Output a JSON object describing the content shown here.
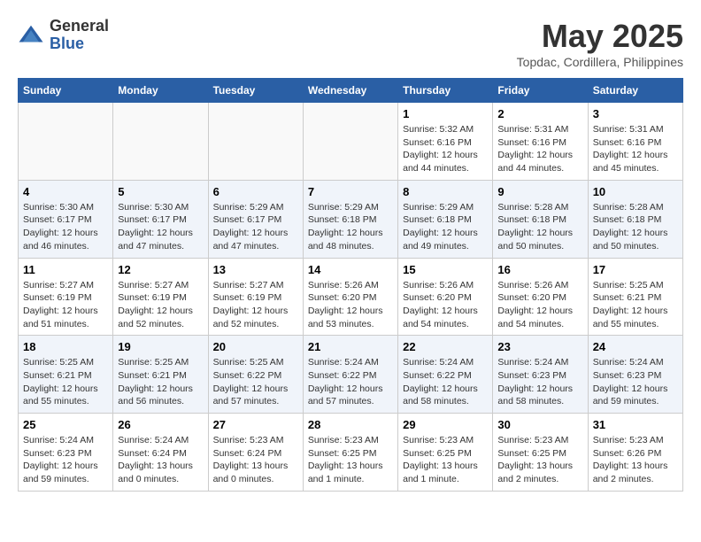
{
  "logo": {
    "general": "General",
    "blue": "Blue"
  },
  "title": "May 2025",
  "subtitle": "Topdac, Cordillera, Philippines",
  "days_of_week": [
    "Sunday",
    "Monday",
    "Tuesday",
    "Wednesday",
    "Thursday",
    "Friday",
    "Saturday"
  ],
  "weeks": [
    [
      {
        "day": "",
        "info": ""
      },
      {
        "day": "",
        "info": ""
      },
      {
        "day": "",
        "info": ""
      },
      {
        "day": "",
        "info": ""
      },
      {
        "day": "1",
        "info": "Sunrise: 5:32 AM\nSunset: 6:16 PM\nDaylight: 12 hours\nand 44 minutes."
      },
      {
        "day": "2",
        "info": "Sunrise: 5:31 AM\nSunset: 6:16 PM\nDaylight: 12 hours\nand 44 minutes."
      },
      {
        "day": "3",
        "info": "Sunrise: 5:31 AM\nSunset: 6:16 PM\nDaylight: 12 hours\nand 45 minutes."
      }
    ],
    [
      {
        "day": "4",
        "info": "Sunrise: 5:30 AM\nSunset: 6:17 PM\nDaylight: 12 hours\nand 46 minutes."
      },
      {
        "day": "5",
        "info": "Sunrise: 5:30 AM\nSunset: 6:17 PM\nDaylight: 12 hours\nand 47 minutes."
      },
      {
        "day": "6",
        "info": "Sunrise: 5:29 AM\nSunset: 6:17 PM\nDaylight: 12 hours\nand 47 minutes."
      },
      {
        "day": "7",
        "info": "Sunrise: 5:29 AM\nSunset: 6:18 PM\nDaylight: 12 hours\nand 48 minutes."
      },
      {
        "day": "8",
        "info": "Sunrise: 5:29 AM\nSunset: 6:18 PM\nDaylight: 12 hours\nand 49 minutes."
      },
      {
        "day": "9",
        "info": "Sunrise: 5:28 AM\nSunset: 6:18 PM\nDaylight: 12 hours\nand 50 minutes."
      },
      {
        "day": "10",
        "info": "Sunrise: 5:28 AM\nSunset: 6:18 PM\nDaylight: 12 hours\nand 50 minutes."
      }
    ],
    [
      {
        "day": "11",
        "info": "Sunrise: 5:27 AM\nSunset: 6:19 PM\nDaylight: 12 hours\nand 51 minutes."
      },
      {
        "day": "12",
        "info": "Sunrise: 5:27 AM\nSunset: 6:19 PM\nDaylight: 12 hours\nand 52 minutes."
      },
      {
        "day": "13",
        "info": "Sunrise: 5:27 AM\nSunset: 6:19 PM\nDaylight: 12 hours\nand 52 minutes."
      },
      {
        "day": "14",
        "info": "Sunrise: 5:26 AM\nSunset: 6:20 PM\nDaylight: 12 hours\nand 53 minutes."
      },
      {
        "day": "15",
        "info": "Sunrise: 5:26 AM\nSunset: 6:20 PM\nDaylight: 12 hours\nand 54 minutes."
      },
      {
        "day": "16",
        "info": "Sunrise: 5:26 AM\nSunset: 6:20 PM\nDaylight: 12 hours\nand 54 minutes."
      },
      {
        "day": "17",
        "info": "Sunrise: 5:25 AM\nSunset: 6:21 PM\nDaylight: 12 hours\nand 55 minutes."
      }
    ],
    [
      {
        "day": "18",
        "info": "Sunrise: 5:25 AM\nSunset: 6:21 PM\nDaylight: 12 hours\nand 55 minutes."
      },
      {
        "day": "19",
        "info": "Sunrise: 5:25 AM\nSunset: 6:21 PM\nDaylight: 12 hours\nand 56 minutes."
      },
      {
        "day": "20",
        "info": "Sunrise: 5:25 AM\nSunset: 6:22 PM\nDaylight: 12 hours\nand 57 minutes."
      },
      {
        "day": "21",
        "info": "Sunrise: 5:24 AM\nSunset: 6:22 PM\nDaylight: 12 hours\nand 57 minutes."
      },
      {
        "day": "22",
        "info": "Sunrise: 5:24 AM\nSunset: 6:22 PM\nDaylight: 12 hours\nand 58 minutes."
      },
      {
        "day": "23",
        "info": "Sunrise: 5:24 AM\nSunset: 6:23 PM\nDaylight: 12 hours\nand 58 minutes."
      },
      {
        "day": "24",
        "info": "Sunrise: 5:24 AM\nSunset: 6:23 PM\nDaylight: 12 hours\nand 59 minutes."
      }
    ],
    [
      {
        "day": "25",
        "info": "Sunrise: 5:24 AM\nSunset: 6:23 PM\nDaylight: 12 hours\nand 59 minutes."
      },
      {
        "day": "26",
        "info": "Sunrise: 5:24 AM\nSunset: 6:24 PM\nDaylight: 13 hours\nand 0 minutes."
      },
      {
        "day": "27",
        "info": "Sunrise: 5:23 AM\nSunset: 6:24 PM\nDaylight: 13 hours\nand 0 minutes."
      },
      {
        "day": "28",
        "info": "Sunrise: 5:23 AM\nSunset: 6:25 PM\nDaylight: 13 hours\nand 1 minute."
      },
      {
        "day": "29",
        "info": "Sunrise: 5:23 AM\nSunset: 6:25 PM\nDaylight: 13 hours\nand 1 minute."
      },
      {
        "day": "30",
        "info": "Sunrise: 5:23 AM\nSunset: 6:25 PM\nDaylight: 13 hours\nand 2 minutes."
      },
      {
        "day": "31",
        "info": "Sunrise: 5:23 AM\nSunset: 6:26 PM\nDaylight: 13 hours\nand 2 minutes."
      }
    ]
  ]
}
